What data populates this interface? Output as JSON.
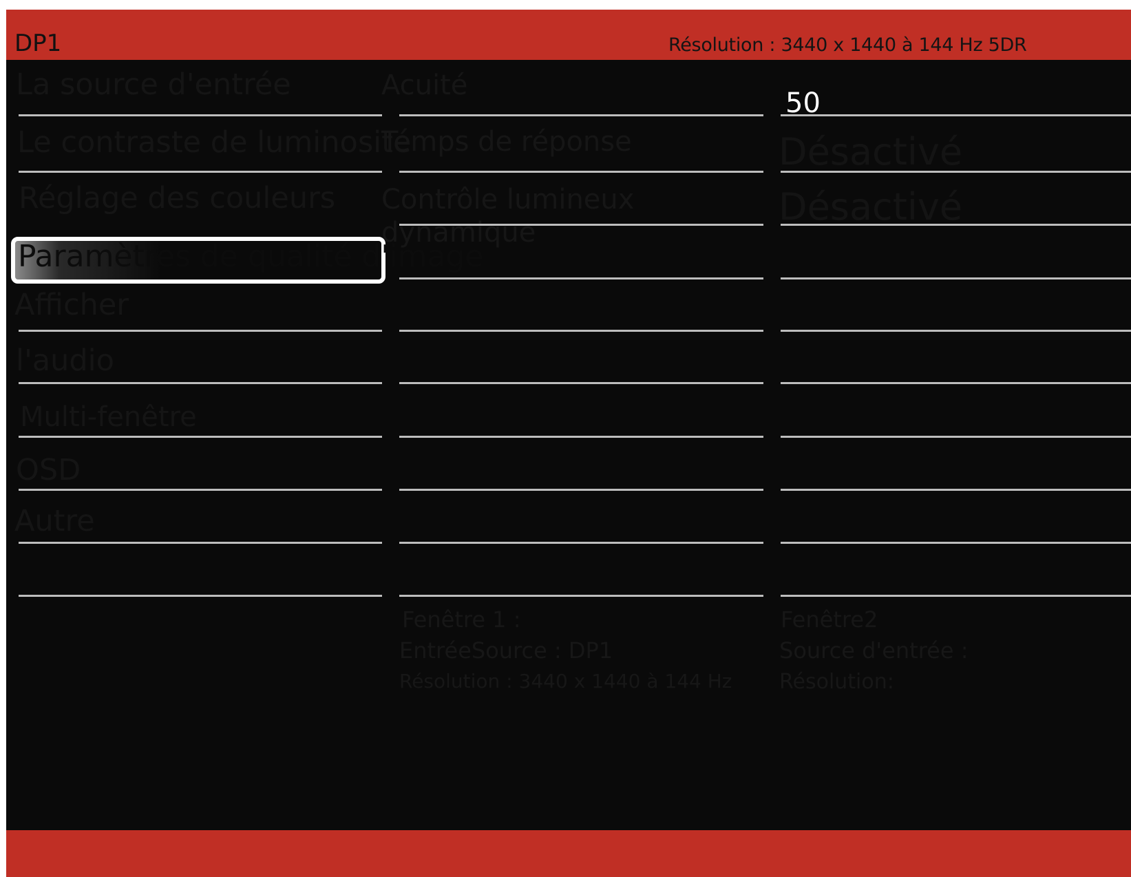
{
  "header": {
    "source": "DP1",
    "resolution": "Résolution : 3440 x 1440 à 144 Hz 5DR"
  },
  "menu": {
    "items": [
      "La source d'entrée",
      "Le contraste de luminosité",
      "Réglage des couleurs",
      "Paramètres de qualité d'image",
      "Afficher",
      "l'audio",
      "Multi-fenêtre",
      "OSD",
      "Autre"
    ],
    "selected": "Paramètres de qualité d'image"
  },
  "submenu": {
    "items": [
      "Acuité",
      "Temps de réponse",
      "Contrôle lumineux dynamique"
    ]
  },
  "values": {
    "acuite": "50",
    "temps_reponse": "Désactivé",
    "controle_lumineux": "Désactivé"
  },
  "footer": {
    "window1": {
      "title": "Fenêtre 1 :",
      "source": "EntréeSource : DP1",
      "resolution": "Résolution : 3440 x 1440 à 144 Hz"
    },
    "window2": {
      "title": "Fenêtre2",
      "source": "Source d'entrée :",
      "resolution": "Résolution:"
    }
  },
  "colors": {
    "bar": "#c02f25",
    "background": "#0a0a0a",
    "divider": "#bdbdbd",
    "selection": "#ffffff"
  }
}
